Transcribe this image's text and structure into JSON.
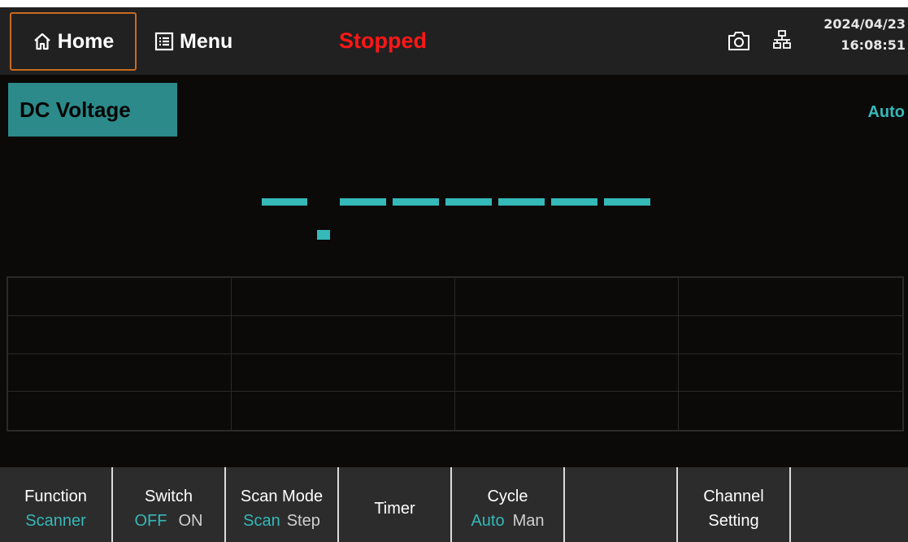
{
  "header": {
    "home_label": "Home",
    "menu_label": "Menu",
    "status": "Stopped",
    "date": "2024/04/23",
    "time": "16:08:51"
  },
  "measurement": {
    "function_label": "DC Voltage",
    "range_mode": "Auto",
    "reading_display": "- -------"
  },
  "softkeys": {
    "function": {
      "title": "Function",
      "value": "Scanner"
    },
    "switch": {
      "title": "Switch",
      "options": [
        "OFF",
        "ON"
      ],
      "selected": "OFF"
    },
    "scan_mode": {
      "title": "Scan Mode",
      "options": [
        "Scan",
        "Step"
      ],
      "selected": "Scan"
    },
    "timer": {
      "label": "Timer"
    },
    "cycle": {
      "title": "Cycle",
      "options": [
        "Auto",
        "Man"
      ],
      "selected": "Auto"
    },
    "channel_setting": {
      "line1": "Channel",
      "line2": "Setting"
    }
  },
  "colors": {
    "accent": "#35b8b8",
    "status_stopped": "#ff1717",
    "home_border": "#c86a1e",
    "function_badge": "#2c8a8a"
  },
  "icons": {
    "home": "home-icon",
    "menu": "menu-list-icon",
    "camera": "camera-icon",
    "network": "network-icon"
  }
}
